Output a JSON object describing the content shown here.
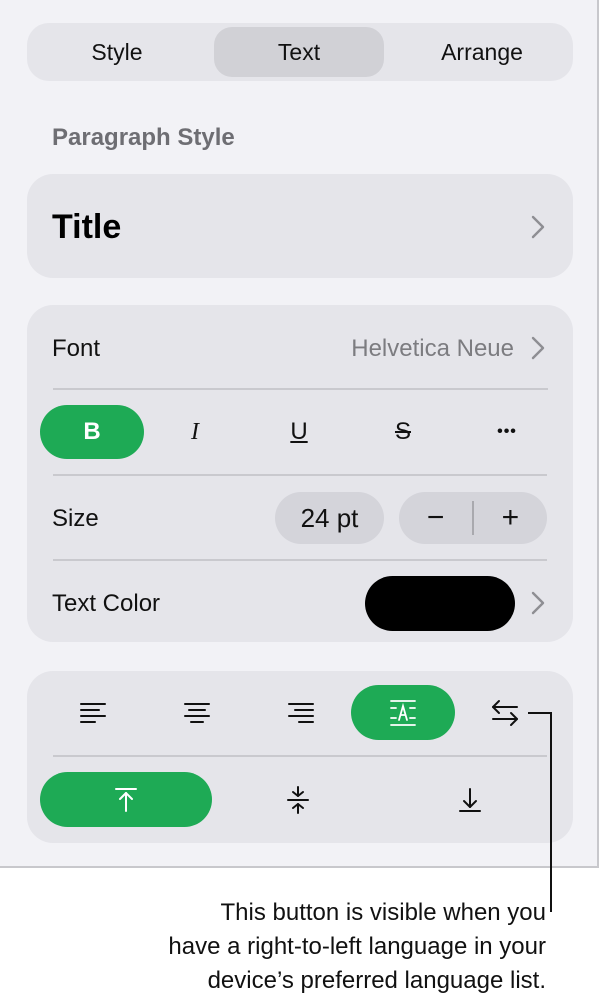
{
  "tabs": [
    {
      "label": "Style",
      "active": false
    },
    {
      "label": "Text",
      "active": true
    },
    {
      "label": "Arrange",
      "active": false
    }
  ],
  "paragraph_style": {
    "section_label": "Paragraph Style",
    "value": "Title"
  },
  "font_row": {
    "label": "Font",
    "value": "Helvetica Neue"
  },
  "style_buttons": [
    {
      "label": "B",
      "name": "bold",
      "active": true
    },
    {
      "label": "I",
      "name": "italic",
      "active": false
    },
    {
      "label": "U",
      "name": "underline",
      "active": false
    },
    {
      "label": "S",
      "name": "strikethrough",
      "active": false
    },
    {
      "label": "•••",
      "name": "more",
      "active": false
    }
  ],
  "size_row": {
    "label": "Size",
    "value": "24 pt",
    "decrement": "−",
    "increment": "+"
  },
  "color_row": {
    "label": "Text Color",
    "swatch_color": "#000000"
  },
  "alignment": {
    "buttons": [
      "align-left",
      "align-center",
      "align-right",
      "justify",
      "text-direction"
    ],
    "active": "justify"
  },
  "vertical_alignment": {
    "buttons": [
      "align-top",
      "align-middle",
      "align-bottom"
    ],
    "active": "align-top"
  },
  "accent_color": "#1eaa55",
  "callout": {
    "lines": [
      "This button is visible when you",
      "have a right-to-left language in your",
      "device’s preferred language list."
    ]
  }
}
